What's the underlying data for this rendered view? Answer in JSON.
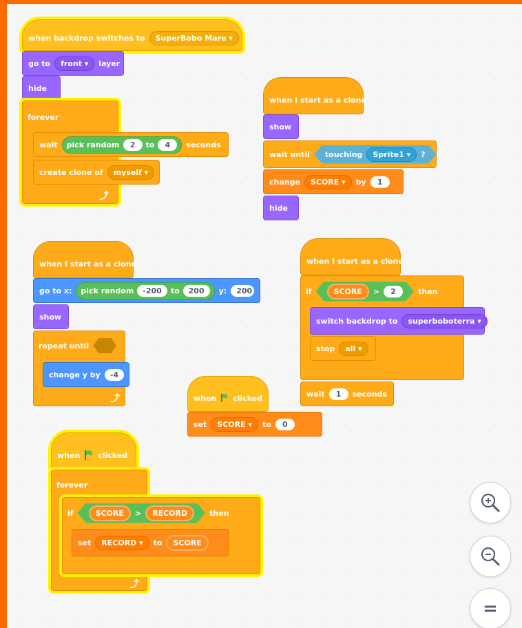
{
  "scripts": {
    "s1": {
      "hat": "when backdrop switches to",
      "backdrop": "SuperBobo Mare",
      "goto": "go to",
      "layer_choice": "front",
      "layer": "layer",
      "hide": "hide",
      "forever": "forever",
      "wait": "wait",
      "pick_random": "pick random",
      "r1": "2",
      "to": "to",
      "r2": "4",
      "seconds": "seconds",
      "create_clone": "create clone of",
      "clone_target": "myself"
    },
    "s2": {
      "hat": "when I start as a clone",
      "show": "show",
      "wait_until": "wait until",
      "touching": "touching",
      "sprite": "Sprite1",
      "q": "?",
      "change": "change",
      "var": "SCORE",
      "by": "by",
      "amount": "1",
      "hide": "hide"
    },
    "s3": {
      "hat": "when I start as a clone",
      "goto_x": "go to x:",
      "pick_random": "pick random",
      "r1": "-200",
      "to": "to",
      "r2": "200",
      "y": "y:",
      "yval": "200",
      "show": "show",
      "repeat_until": "repeat until",
      "change_y": "change y by",
      "dy": "-4"
    },
    "s4": {
      "hat": "when I start as a clone",
      "if": "if",
      "var": "SCORE",
      "gt": ">",
      "val": "2",
      "then": "then",
      "switch_backdrop": "switch backdrop to",
      "backdrop": "superboboterra",
      "stop": "stop",
      "stop_choice": "all",
      "wait": "wait",
      "secs": "1",
      "seconds": "seconds"
    },
    "s5": {
      "hat_when": "when",
      "hat_clicked": "clicked",
      "set": "set",
      "var": "SCORE",
      "to": "to",
      "val": "0"
    },
    "s6": {
      "hat_when": "when",
      "hat_clicked": "clicked",
      "forever": "forever",
      "if": "if",
      "a": "SCORE",
      "gt": ">",
      "b": "RECORD",
      "then": "then",
      "set": "set",
      "var": "RECORD",
      "to": "to",
      "val": "SCORE"
    }
  },
  "zoom": {
    "in_icon": "zoom-in-icon",
    "out_icon": "zoom-out-icon",
    "reset_icon": "zoom-reset-icon",
    "reset_glyph": "="
  },
  "colors": {
    "frame": "#ff6a00",
    "events": "#ffbf1f",
    "control": "#ffab19",
    "looks": "#9966ff",
    "motion": "#4c97ff",
    "variables": "#ff8c1a",
    "operators": "#59c059",
    "sensing": "#5cb1d6",
    "highlight": "#fff200"
  }
}
